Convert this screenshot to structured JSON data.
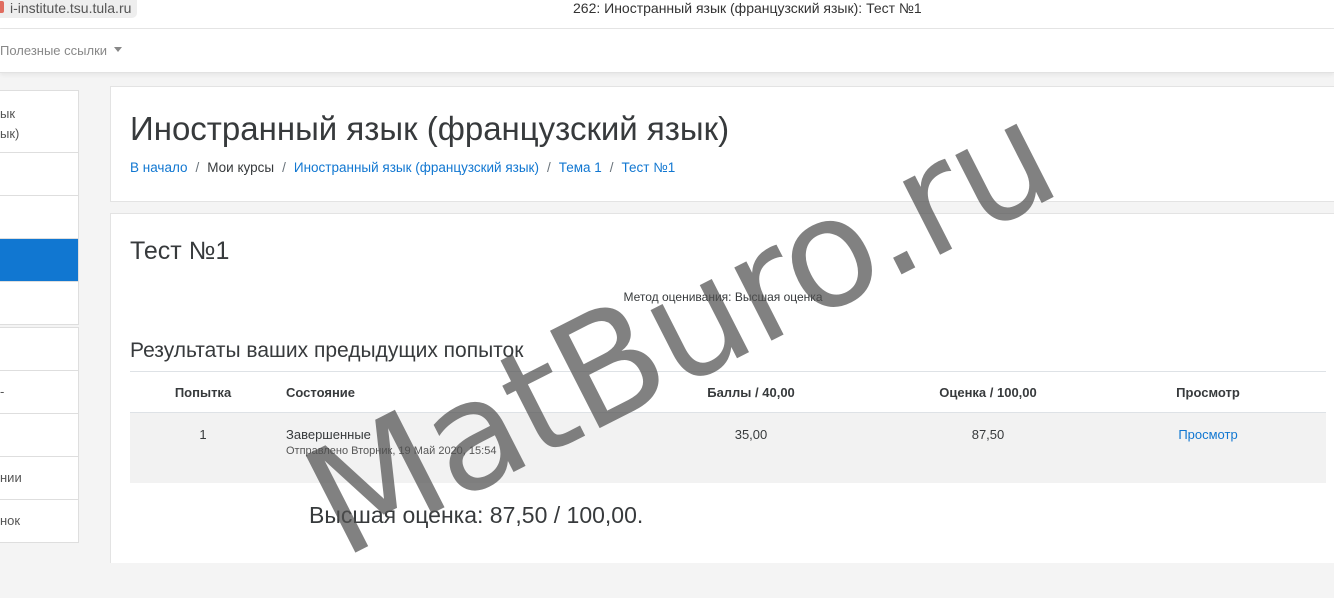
{
  "browser": {
    "url": "i-institute.tsu.tula.ru",
    "window_title": "262: Иностранный язык (французский язык): Тест №1"
  },
  "navbar": {
    "useful_links": "Полезные ссылки"
  },
  "sidebar": {
    "items_top": [
      {
        "label": "ык\nык)"
      },
      {
        "label": ""
      },
      {
        "label": ""
      },
      {
        "label": "",
        "active": true
      },
      {
        "label": ""
      }
    ],
    "items_bottom": [
      {
        "label": ""
      },
      {
        "label": "-"
      },
      {
        "label": ""
      },
      {
        "label": "нии"
      },
      {
        "label": "нок"
      }
    ]
  },
  "page_header": {
    "title": "Иностранный язык (французский язык)",
    "breadcrumb": {
      "home": "В начало",
      "my_courses": "Мои курсы",
      "course": "Иностранный язык (французский язык)",
      "topic": "Тема 1",
      "quiz": "Тест №1",
      "separator": "/"
    }
  },
  "quiz": {
    "title": "Тест №1",
    "grading_method": "Метод оценивания: Высшая оценка",
    "results_heading": "Результаты ваших предыдущих попыток",
    "table": {
      "headers": {
        "attempt": "Попытка",
        "state": "Состояние",
        "marks": "Баллы / 40,00",
        "grade": "Оценка / 100,00",
        "review": "Просмотр"
      },
      "rows": [
        {
          "attempt": "1",
          "state": "Завершенные",
          "submitted": "Отправлено Вторник, 19 Май 2020, 15:54",
          "marks": "35,00",
          "grade": "87,50",
          "review": "Просмотр"
        }
      ]
    },
    "best_grade": "Высшая оценка: 87,50 / 100,00."
  },
  "watermark": "MatBuro.ru"
}
